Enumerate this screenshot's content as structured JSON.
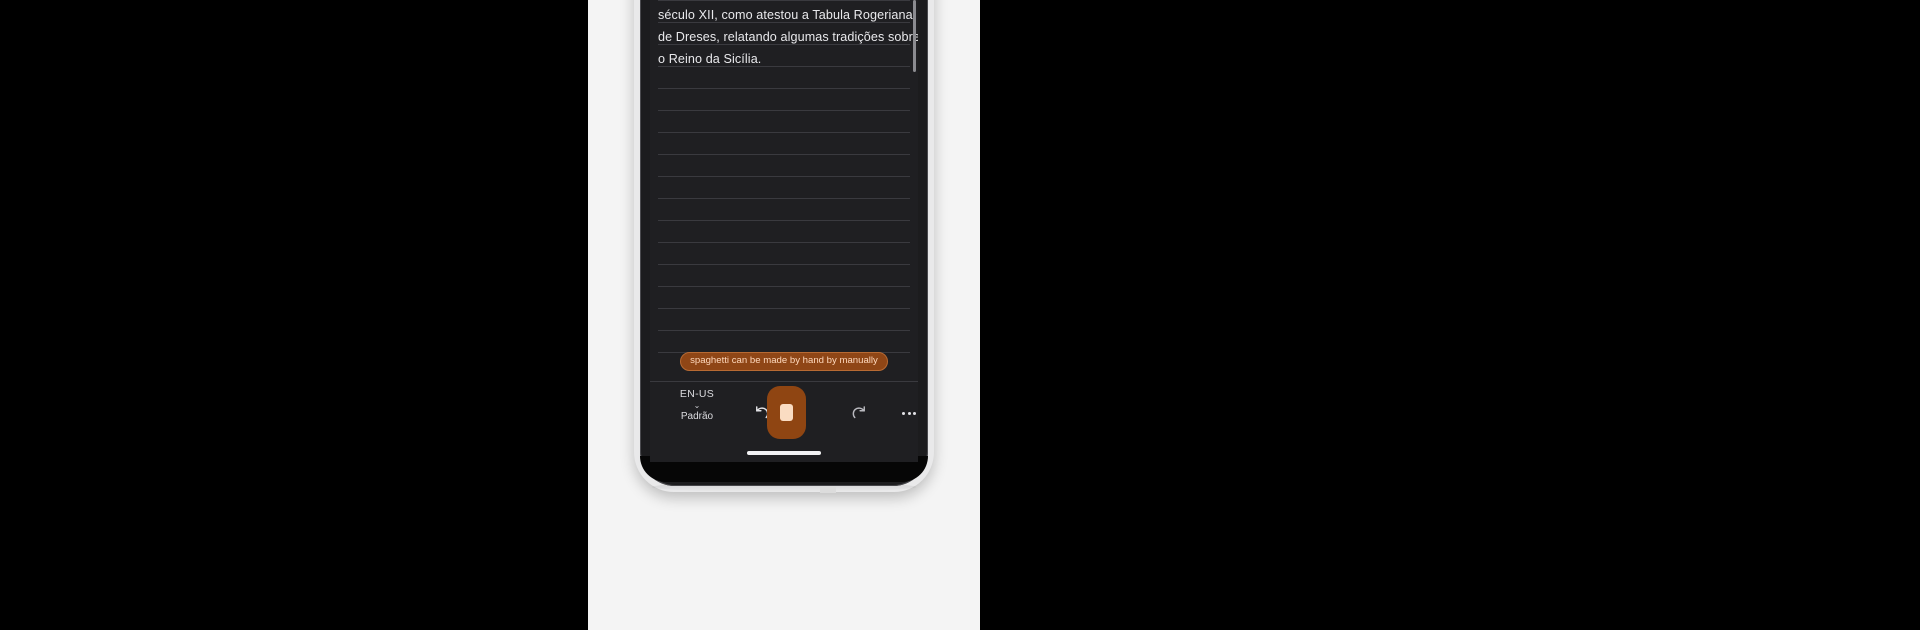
{
  "app": {
    "type": "mobile-voice-dictation-notepad",
    "device": "smartphone-mockup"
  },
  "note": {
    "partial_top_line": "",
    "lines": [
      "século XII, como atestou a Tabula Rogeriana",
      "de Dreses, relatando algumas tradições sobre",
      "o Reino da Sicília."
    ],
    "ruled_line_count": 17,
    "rule_color": "#3a3a3f",
    "text_color": "#e9e9ec",
    "background": "#1f1f22"
  },
  "scrollbar": {
    "name": "vertical-scrollbar",
    "thumb_color": "#8b8b90",
    "position": "top"
  },
  "suggestion": {
    "text": "spaghetti can be made by hand by manually",
    "background": "#8f4616",
    "border": "#b76a33",
    "text_color": "#ffd9bd"
  },
  "toolbar": {
    "language_code": "EN-US",
    "language_mode": "Padrão",
    "chevron": "⌄",
    "undo_label": "undo",
    "redo_label": "redo",
    "more_label": "more options",
    "record_label": "stop recording",
    "accent_color": "#8f4512",
    "record_inner_color": "#fadcc2",
    "divider_color": "#3a3a3f"
  },
  "system": {
    "home_indicator": "home-indicator",
    "home_indicator_color": "#f2f2f4"
  },
  "canvas": {
    "page_background": "#f4f4f4",
    "outer_background": "#000000",
    "device_frame_color": "#e9e9ea",
    "device_bezel_color": "#1c1c1e"
  }
}
